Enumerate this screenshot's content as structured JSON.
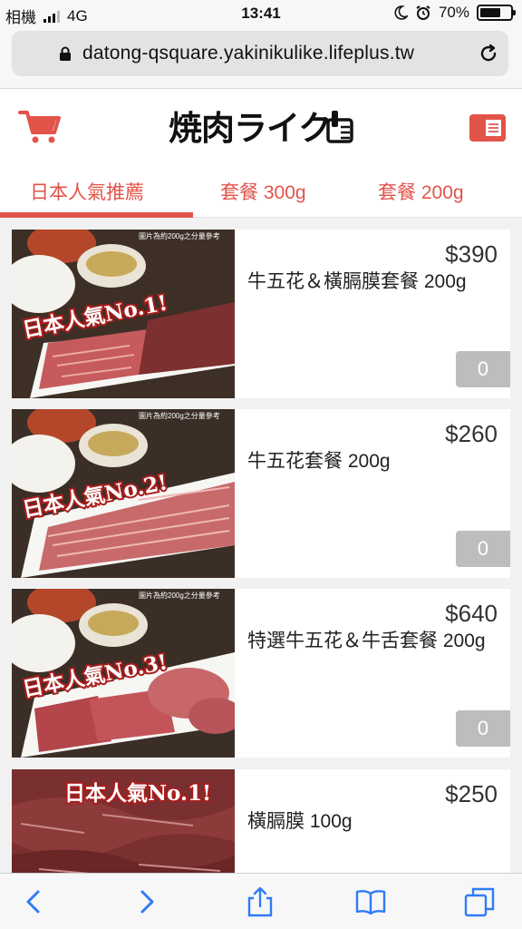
{
  "status_bar": {
    "carrier": "相機",
    "network": "4G",
    "time": "13:41",
    "battery_text": "70%",
    "battery_level": 0.7
  },
  "browser": {
    "url": "datong-qsquare.yakinikulike.lifeplus.tw"
  },
  "header": {
    "logo_text": "焼肉ライク",
    "brand_color": "#e2534a"
  },
  "tabs": [
    {
      "label": "日本人氣推薦",
      "active": true
    },
    {
      "label": "套餐 300g",
      "active": false
    },
    {
      "label": "套餐 200g",
      "active": false
    }
  ],
  "products": [
    {
      "price": "$390",
      "name": "牛五花＆橫膈膜套餐 200g",
      "qty": "0",
      "badge": "日本人氣No.1!",
      "note": "圖片為約200g之分量參考"
    },
    {
      "price": "$260",
      "name": "牛五花套餐 200g",
      "qty": "0",
      "badge": "日本人氣No.2!",
      "note": "圖片為約200g之分量參考"
    },
    {
      "price": "$640",
      "name": "特選牛五花＆牛舌套餐 200g",
      "qty": "0",
      "badge": "日本人氣No.3!",
      "note": "圖片為約200g之分量參考"
    },
    {
      "price": "$250",
      "name": "橫膈膜 100g",
      "qty": "",
      "badge": "日本人氣No.1!",
      "note": ""
    }
  ],
  "toolbar": {
    "icons": [
      "back-icon",
      "forward-icon",
      "share-icon",
      "bookmarks-icon",
      "tabs-icon"
    ]
  }
}
